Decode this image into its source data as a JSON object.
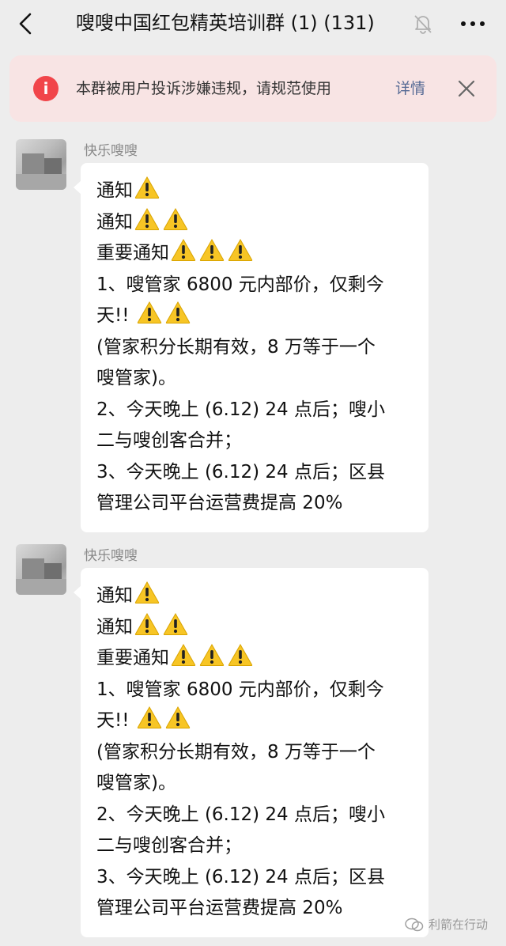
{
  "header": {
    "title": "嗖嗖中国红包精英培训群 (1) (131)",
    "back_icon": "chevron-left-icon",
    "mute_icon": "bell-off-icon",
    "more_icon": "more-dots-icon"
  },
  "warning_bar": {
    "icon": "exclamation-circle-icon",
    "text": "本群被用户投诉涉嫌违规，请规范使用",
    "detail_label": "详情",
    "close_icon": "close-icon",
    "colors": {
      "background": "#f8e4e4",
      "icon": "#f1454a",
      "link": "#576b95"
    }
  },
  "messages": [
    {
      "sender": "快乐嗖嗖",
      "lines": [
        {
          "text": "通知",
          "warnings": 1
        },
        {
          "text": "通知",
          "warnings": 2
        },
        {
          "text": "重要通知",
          "warnings": 3
        },
        {
          "text": "1、嗖管家 6800 元内部价，仅剩今",
          "warnings": 0
        },
        {
          "text": "天!! ",
          "warnings": 2
        },
        {
          "text": "(管家积分长期有效，8 万等于一个",
          "warnings": 0
        },
        {
          "text": "嗖管家)。",
          "warnings": 0
        },
        {
          "text": "2、今天晚上 (6.12) 24 点后；嗖小",
          "warnings": 0
        },
        {
          "text": "二与嗖创客合并；",
          "warnings": 0
        },
        {
          "text": "3、今天晚上 (6.12) 24 点后；区县",
          "warnings": 0
        },
        {
          "text": "管理公司平台运营费提高 20%",
          "warnings": 0
        }
      ]
    },
    {
      "sender": "快乐嗖嗖",
      "lines": [
        {
          "text": "通知",
          "warnings": 1
        },
        {
          "text": "通知",
          "warnings": 2
        },
        {
          "text": "重要通知",
          "warnings": 3
        },
        {
          "text": "1、嗖管家 6800 元内部价，仅剩今",
          "warnings": 0
        },
        {
          "text": "天!! ",
          "warnings": 2
        },
        {
          "text": "(管家积分长期有效，8 万等于一个",
          "warnings": 0
        },
        {
          "text": "嗖管家)。",
          "warnings": 0
        },
        {
          "text": "2、今天晚上 (6.12) 24 点后；嗖小",
          "warnings": 0
        },
        {
          "text": "二与嗖创客合并；",
          "warnings": 0
        },
        {
          "text": "3、今天晚上 (6.12) 24 点后；区县",
          "warnings": 0
        },
        {
          "text": "管理公司平台运营费提高 20%",
          "warnings": 0
        }
      ]
    }
  ],
  "watermark": {
    "text": "利箭在行动",
    "icon": "wechat-official-account-icon"
  }
}
